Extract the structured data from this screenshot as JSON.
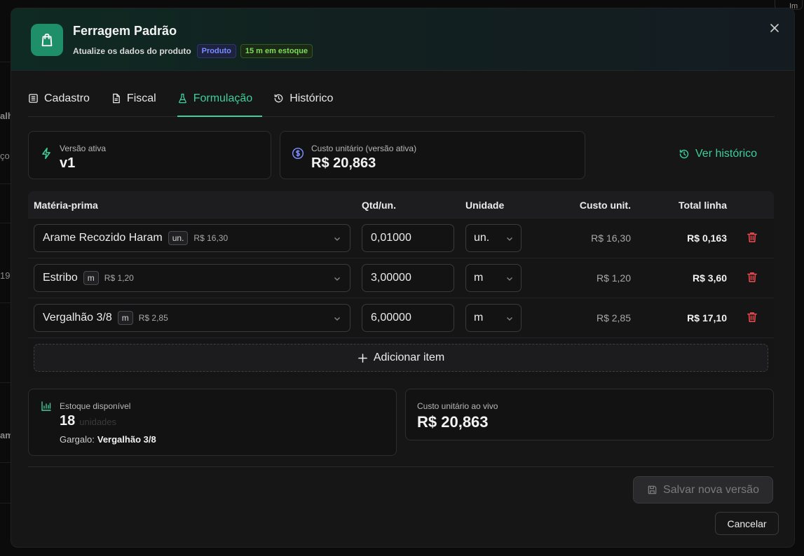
{
  "background": {
    "fragments": [
      "alh",
      "ço",
      "19",
      "am"
    ],
    "topright": "Im"
  },
  "header": {
    "title": "Ferragem Padrão",
    "subtitle": "Atualize os dados do produto",
    "badge_type": "Produto",
    "badge_stock": "15 m em estoque",
    "icon": "shopping-bag-icon"
  },
  "tabs": [
    {
      "label": "Cadastro",
      "icon": "form-icon"
    },
    {
      "label": "Fiscal",
      "icon": "document-icon"
    },
    {
      "label": "Formulação",
      "icon": "flask-icon",
      "active": true
    },
    {
      "label": "Histórico",
      "icon": "history-icon"
    }
  ],
  "version_card": {
    "label": "Versão ativa",
    "value": "v1"
  },
  "cost_card": {
    "label": "Custo unitário (versão ativa)",
    "value": "R$ 20,863"
  },
  "ver_historico": "Ver histórico",
  "table": {
    "headers": {
      "materia": "Matéria-prima",
      "qtd": "Qtd/un.",
      "unidade": "Unidade",
      "custo": "Custo unit.",
      "total": "Total linha"
    },
    "rows": [
      {
        "name": "Arame Recozido Haram",
        "chip": "un.",
        "price": "R$ 16,30",
        "qty": "0,01000",
        "unit": "un.",
        "custo": "R$ 16,30",
        "total": "R$ 0,163"
      },
      {
        "name": "Estribo",
        "chip": "m",
        "price": "R$ 1,20",
        "qty": "3,00000",
        "unit": "m",
        "custo": "R$ 1,20",
        "total": "R$ 3,60"
      },
      {
        "name": "Vergalhão 3/8",
        "chip": "m",
        "price": "R$ 2,85",
        "qty": "6,00000",
        "unit": "m",
        "custo": "R$ 2,85",
        "total": "R$ 17,10"
      }
    ],
    "add_label": "Adicionar item"
  },
  "estoque_card": {
    "label": "Estoque disponível",
    "value": "18",
    "unit": "unidades",
    "gargalo_label": "Gargalo:",
    "gargalo_value": "Vergalhão 3/8"
  },
  "live_card": {
    "label": "Custo unitário ao vivo",
    "value": "R$ 20,863"
  },
  "footer": {
    "save_label": "Salvar nova versão",
    "cancel_label": "Cancelar"
  },
  "colors": {
    "accent": "#3ecf9a",
    "danger": "#e5484d",
    "product_badge": "#7b8cff",
    "stock_badge": "#7fdc5e"
  }
}
